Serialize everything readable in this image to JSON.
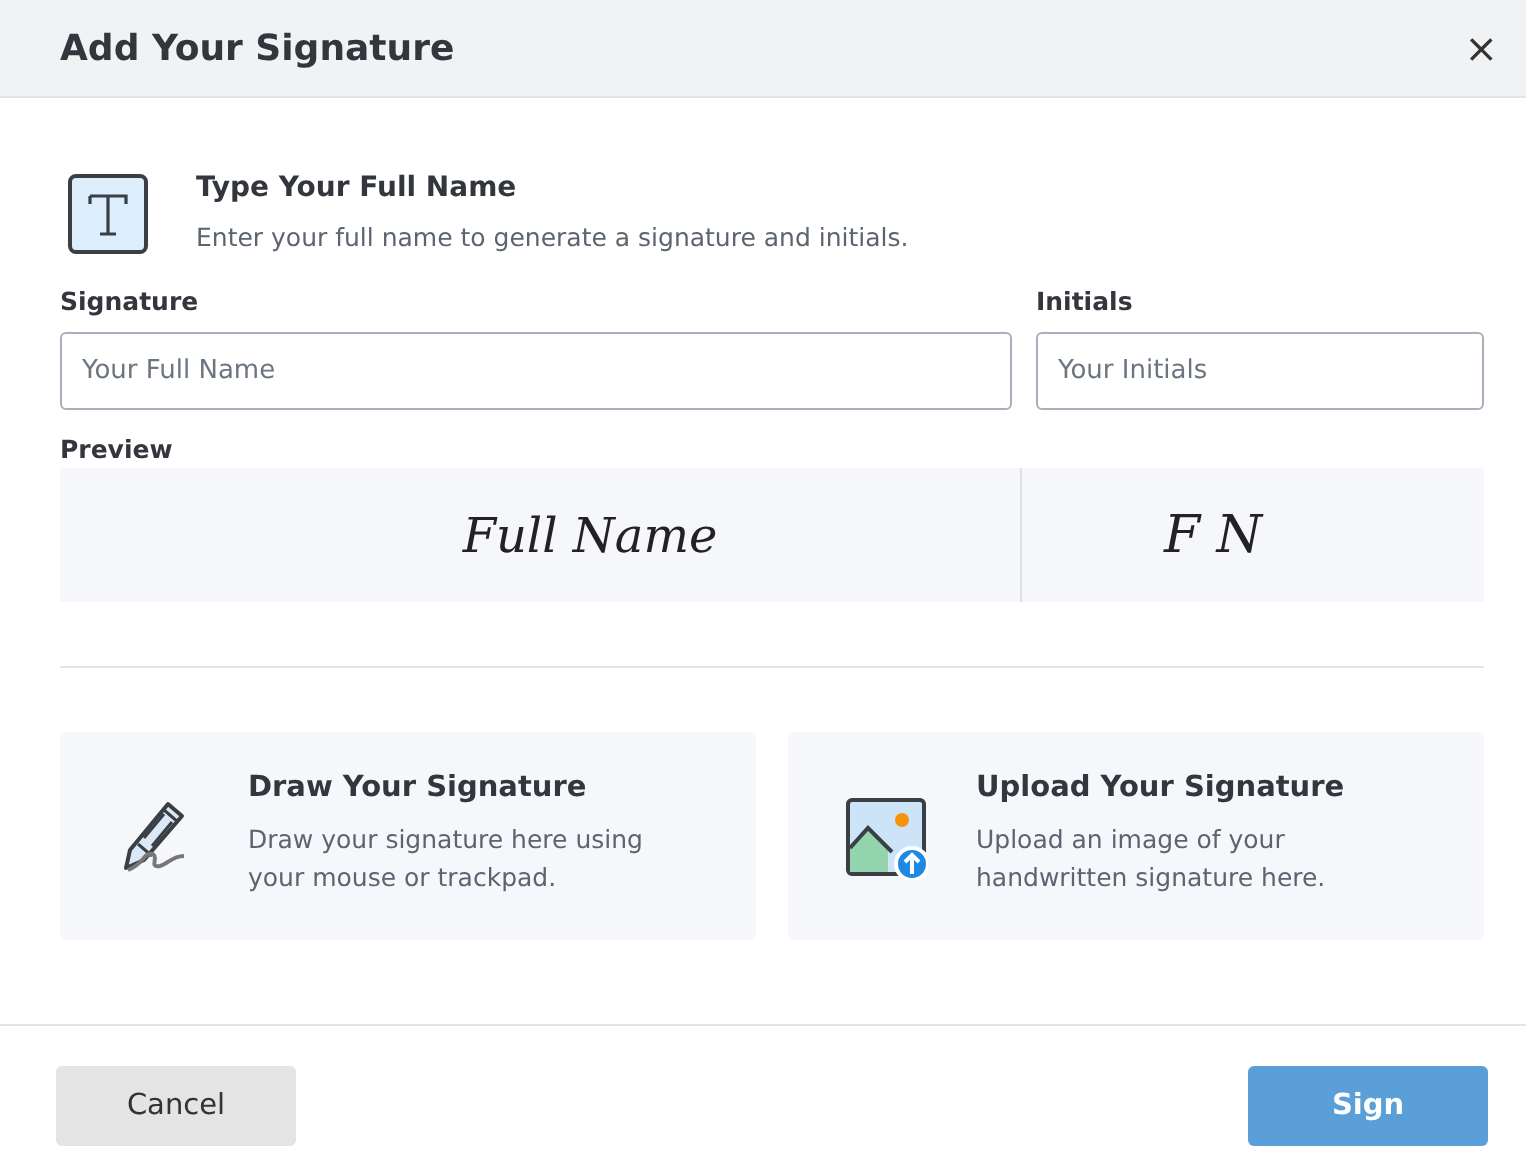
{
  "dialog": {
    "title": "Add Your Signature",
    "close": "×"
  },
  "type_section": {
    "heading": "Type Your Full Name",
    "description": "Enter your full name to generate a signature and initials."
  },
  "fields": [
    {
      "label": "Signature",
      "placeholder": "Your Full Name"
    },
    {
      "label": "Initials",
      "placeholder": "Your Initials"
    }
  ],
  "preview": {
    "label": "Preview",
    "signature": "Full Name",
    "initials": "F N"
  },
  "options": [
    {
      "kind": "draw",
      "title": "Draw Your Signature",
      "description": "Draw your signature here using your mouse or trackpad."
    },
    {
      "kind": "upload",
      "title": "Upload Your Signature",
      "description": "Upload an image of your handwritten signature here."
    }
  ],
  "buttons": [
    {
      "kind": "secondary",
      "label": "Cancel"
    },
    {
      "kind": "primary",
      "label": "Sign"
    }
  ]
}
